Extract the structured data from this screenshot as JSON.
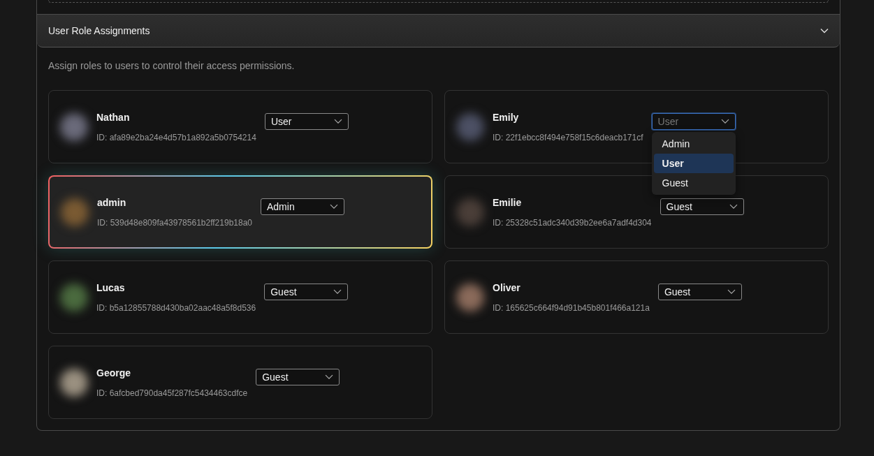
{
  "section": {
    "title": "User Role Assignments",
    "expanded": true,
    "description": "Assign roles to users to control their access permissions."
  },
  "users": [
    {
      "name": "Nathan",
      "id_text": "ID: afa89e2ba24e4d57b1a892a5b0754214",
      "role": "User",
      "color": "#6a6a7a",
      "highlighted": false,
      "open": false
    },
    {
      "name": "Emily",
      "id_text": "ID: 22f1ebcc8f494e758f15c6deacb171cf",
      "role": "User",
      "color": "#4c5064",
      "highlighted": false,
      "open": true,
      "options": [
        {
          "label": "Admin",
          "selected": false
        },
        {
          "label": "User",
          "selected": true
        },
        {
          "label": "Guest",
          "selected": false
        }
      ]
    },
    {
      "name": "admin",
      "id_text": "ID: 539d48e809fa43978561b2ff219b18a0",
      "role": "Admin",
      "color": "#7a5a32",
      "highlighted": true,
      "open": false
    },
    {
      "name": "Emilie",
      "id_text": "ID: 25328c51adc340d39b2ee6a7adf4d304",
      "role": "Guest",
      "color": "#4a3e38",
      "highlighted": false,
      "open": false
    },
    {
      "name": "Lucas",
      "id_text": "ID: b5a12855788d430ba02aac48a5f8d536",
      "role": "Guest",
      "color": "#4a6a3e",
      "highlighted": false,
      "open": false
    },
    {
      "name": "Oliver",
      "id_text": "ID: 165625c664f94d91b45b801f466a121a",
      "role": "Guest",
      "color": "#8a6a5a",
      "highlighted": false,
      "open": false
    },
    {
      "name": "George",
      "id_text": "ID: 6afcbed790da45f287fc5434463cdfce",
      "role": "Guest",
      "color": "#9a9080",
      "highlighted": false,
      "open": false
    }
  ]
}
